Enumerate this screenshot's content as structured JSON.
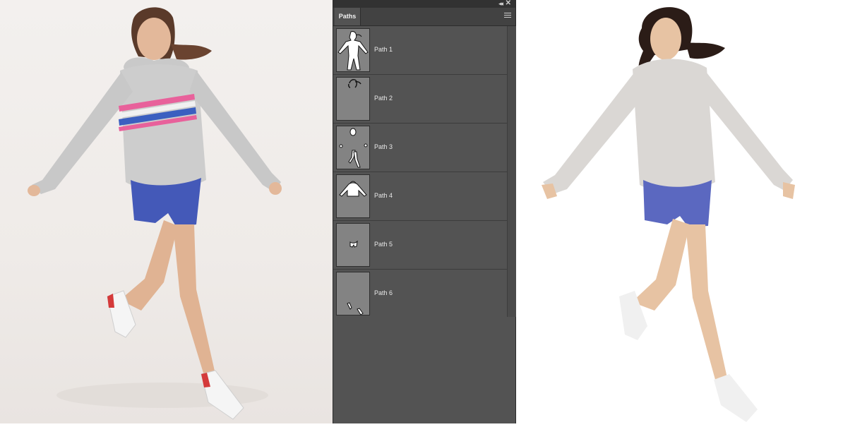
{
  "panel": {
    "tab_label": "Paths",
    "collapse_icon": "double-chevron-left-icon",
    "close_icon": "close-icon",
    "menu_icon": "panel-menu-icon",
    "paths": [
      {
        "label": "Path 1"
      },
      {
        "label": "Path 2"
      },
      {
        "label": "Path 3"
      },
      {
        "label": "Path 4"
      },
      {
        "label": "Path 5"
      },
      {
        "label": "Path 6"
      }
    ]
  },
  "colors": {
    "panel_bg": "#535353",
    "panel_header": "#424242",
    "thumb_bg": "#838383",
    "sweatshirt": "#dad7d4",
    "shorts": "#5b68c0",
    "skin": "#e7c3a3",
    "hair": "#2b1c17"
  }
}
